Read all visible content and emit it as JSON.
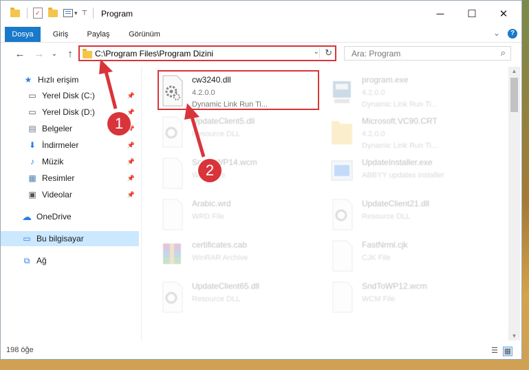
{
  "window": {
    "title": "Program",
    "controls": {
      "minimize": "─",
      "maximize": "☐",
      "close": "✕"
    }
  },
  "ribbon": {
    "tabs": [
      {
        "label": "Dosya",
        "active": true
      },
      {
        "label": "Giriş"
      },
      {
        "label": "Paylaş"
      },
      {
        "label": "Görünüm"
      }
    ],
    "help": "?",
    "collapse": "⌄"
  },
  "address": {
    "path": "C:\\Program Files\\Program Dizini",
    "dropdown": "⌄",
    "refresh": "↻"
  },
  "search": {
    "placeholder": "Ara: Program",
    "icon": "search-icon"
  },
  "nav": {
    "back": "←",
    "forward": "→",
    "recent": "⌄",
    "up": "↑"
  },
  "sidebar": {
    "items": [
      {
        "label": "Hızlı erişim",
        "icon": "star-icon",
        "glyph": "★",
        "color": "#2b7de9"
      },
      {
        "label": "Yerel Disk (C:)",
        "icon": "drive-icon",
        "glyph": "▭",
        "pinned": true
      },
      {
        "label": "Yerel Disk (D:)",
        "icon": "drive-icon",
        "glyph": "▭",
        "pinned": true
      },
      {
        "label": "Belgeler",
        "icon": "documents-icon",
        "glyph": "▤",
        "pinned": true
      },
      {
        "label": "İndirmeler",
        "icon": "download-icon",
        "glyph": "⬇",
        "color": "#2b7de9",
        "pinned": true
      },
      {
        "label": "Müzik",
        "icon": "music-icon",
        "glyph": "♪",
        "color": "#2b7de9",
        "pinned": true
      },
      {
        "label": "Resimler",
        "icon": "pictures-icon",
        "glyph": "▦",
        "pinned": true
      },
      {
        "label": "Videolar",
        "icon": "video-icon",
        "glyph": "▣",
        "pinned": true
      },
      {
        "label": "OneDrive",
        "icon": "cloud-icon",
        "glyph": "☁",
        "color": "#2b7de9"
      },
      {
        "label": "Bu bilgisayar",
        "icon": "computer-icon",
        "glyph": "▭",
        "color": "#2b7de9",
        "selected": true
      },
      {
        "label": "Ağ",
        "icon": "network-icon",
        "glyph": "⧉",
        "color": "#2b7de9"
      }
    ]
  },
  "files": [
    {
      "name": "cw3240.dll",
      "line2": "4.2.0.0",
      "line3": "Dynamic Link Run Ti...",
      "icon": "dll-gear-icon",
      "highlighted": true
    },
    {
      "name": "program.exe",
      "line2": "4.2.0.0",
      "line3": "Dynamic Link Run Ti...",
      "icon": "exe-icon"
    },
    {
      "name": "UpdateClient5.dll",
      "line2": "Resource DLL",
      "line3": "",
      "icon": "dll-gear-icon"
    },
    {
      "name": "Microsoft.VC90.CRT",
      "line2": "4.2.0.0",
      "line3": "Dynamic Link Run Ti...",
      "icon": "folder-icon"
    },
    {
      "name": "SndToWP14.wcm",
      "line2": "WCM File",
      "line3": "",
      "icon": "file-icon"
    },
    {
      "name": "UpdateInstaller.exe",
      "line2": "ABBYY updates installer",
      "line3": "",
      "icon": "installer-icon"
    },
    {
      "name": "Arabic.wrd",
      "line2": "WRD File",
      "line3": "",
      "icon": "file-icon"
    },
    {
      "name": "UpdateClient21.dll",
      "line2": "Resource DLL",
      "line3": "",
      "icon": "dll-gear-icon"
    },
    {
      "name": "certificates.cab",
      "line2": "WinRAR Archive",
      "line3": "",
      "icon": "winrar-icon"
    },
    {
      "name": "FastNrml.cjk",
      "line2": "CJK File",
      "line3": "",
      "icon": "file-icon"
    },
    {
      "name": "UpdateClient65.dll",
      "line2": "Resource DLL",
      "line3": "",
      "icon": "dll-gear-icon"
    },
    {
      "name": "SndToWP12.wcm",
      "line2": "WCM File",
      "line3": "",
      "icon": "file-icon"
    }
  ],
  "status": {
    "count": "198 öğe"
  },
  "callouts": {
    "one": "1",
    "two": "2"
  },
  "colors": {
    "accent": "#1979ca",
    "callout": "#d9343a",
    "selection": "#cce8ff"
  }
}
